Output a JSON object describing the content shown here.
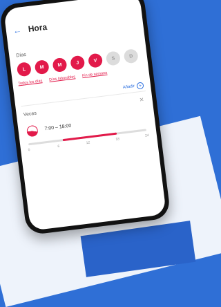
{
  "header": {
    "title": "Hora"
  },
  "days": {
    "label": "Días",
    "items": [
      {
        "letter": "L",
        "active": true
      },
      {
        "letter": "M",
        "active": true
      },
      {
        "letter": "M",
        "active": true
      },
      {
        "letter": "J",
        "active": true
      },
      {
        "letter": "V",
        "active": true
      },
      {
        "letter": "S",
        "active": false
      },
      {
        "letter": "D",
        "active": false
      }
    ],
    "presets": [
      "Todos los días",
      "Días laborables",
      "Fin de semana"
    ]
  },
  "add_label": "Añadir",
  "schedule": {
    "label": "Veces",
    "time_range": "7:00 – 18:00",
    "range_start_hour": 7,
    "range_end_hour": 18,
    "scale_max": 24,
    "tick_labels": [
      "0",
      "6",
      "12",
      "18",
      "24"
    ]
  },
  "colors": {
    "accent": "#e21a4a",
    "link": "#2b6fe0"
  },
  "icons": {
    "back": "arrow-left-icon",
    "add": "plus-circle-icon",
    "close": "close-icon"
  }
}
